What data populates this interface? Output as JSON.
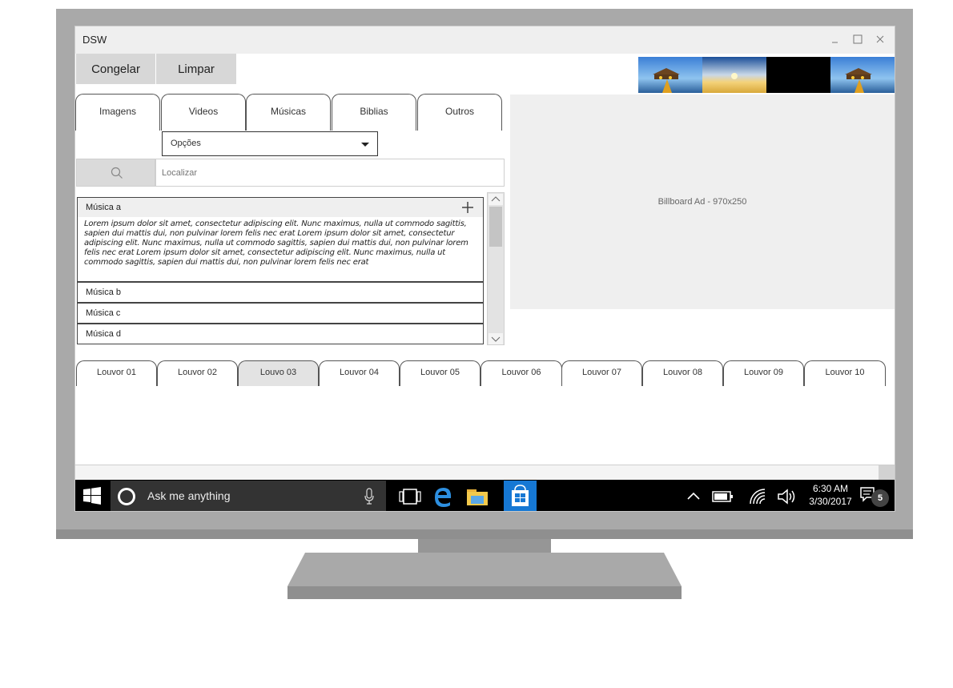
{
  "window": {
    "title": "DSW"
  },
  "toolbar": {
    "freeze_label": "Congelar",
    "clear_label": "Limpar"
  },
  "tabs": [
    {
      "label": "Imagens"
    },
    {
      "label": "Videos"
    },
    {
      "label": "Músicas"
    },
    {
      "label": "Biblias"
    },
    {
      "label": "Outros"
    }
  ],
  "options_select": {
    "selected": "Opções"
  },
  "search": {
    "placeholder": "Localizar"
  },
  "songs": [
    {
      "label": "Música a",
      "expanded": true,
      "content": "Lorem ipsum dolor sit amet, consectetur adipiscing elit. Nunc maximus, nulla ut commodo sagittis, sapien dui mattis dui, non pulvinar lorem felis nec erat Lorem ipsum dolor sit amet, consectetur adipiscing elit. Nunc maximus, nulla ut commodo sagittis, sapien dui mattis dui, non pulvinar lorem felis nec erat Lorem ipsum dolor sit amet, consectetur adipiscing elit. Nunc maximus, nulla ut commodo sagittis, sapien dui mattis dui, non pulvinar lorem felis nec erat"
    },
    {
      "label": "Música b"
    },
    {
      "label": "Música c"
    },
    {
      "label": "Música d"
    }
  ],
  "billboard": {
    "label": "Billboard Ad - 970x250"
  },
  "louvor_tabs": [
    {
      "label": "Louvor 01"
    },
    {
      "label": "Louvor 02"
    },
    {
      "label": "Louvo 03",
      "active": true
    },
    {
      "label": "Louvor 04"
    },
    {
      "label": "Louvor 05"
    },
    {
      "label": "Louvor 06"
    },
    {
      "label": "Louvor 07"
    },
    {
      "label": "Louvor 08"
    },
    {
      "label": "Louvor 09"
    },
    {
      "label": "Louvor 10"
    }
  ],
  "taskbar": {
    "search_text": "Ask me anything",
    "time": "6:30 AM",
    "date": "3/30/2017",
    "notification_count": "5"
  },
  "colors": {
    "store_tile": "#1678d4",
    "taskbar": "#000000",
    "search_box": "#333333"
  },
  "icons": [
    "windows-start-icon",
    "cortana-icon",
    "microphone-icon",
    "task-view-icon",
    "edge-icon",
    "file-explorer-icon",
    "store-icon",
    "chevron-up-icon",
    "battery-icon",
    "wifi-icon",
    "volume-icon",
    "action-center-icon",
    "search-icon",
    "plus-icon",
    "minimize-icon",
    "maximize-icon",
    "close-icon"
  ]
}
